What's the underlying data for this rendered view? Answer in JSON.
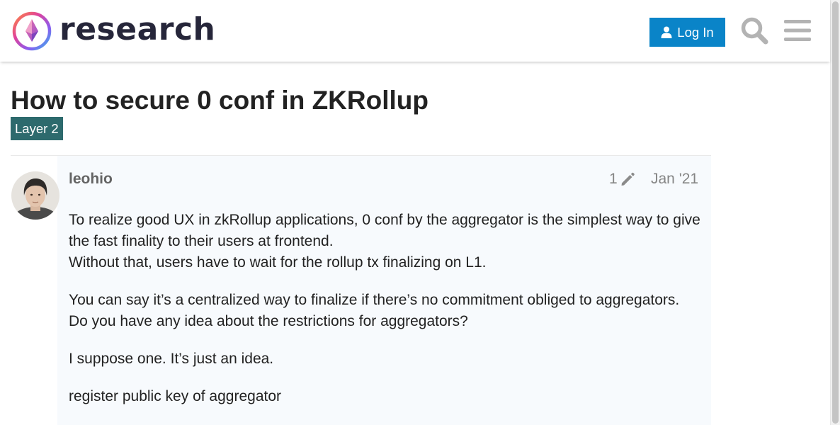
{
  "header": {
    "brand": "research",
    "login_label": "Log In",
    "icons": {
      "logo": "ethereum-research-logo",
      "user": "user-icon",
      "search": "search-icon",
      "menu": "hamburger-menu-icon"
    }
  },
  "topic": {
    "title": "How to secure 0 conf in ZKRollup",
    "category": "Layer 2"
  },
  "post": {
    "username": "leohio",
    "edit_count": "1",
    "date": "Jan '21",
    "paragraphs": [
      [
        "To realize good UX in zkRollup applications, 0 conf by the aggregator is the simplest way to give the fast finality to their users at frontend.",
        "Without that, users have to wait for the rollup tx finalizing on L1."
      ],
      [
        "You can say it’s a centralized way to finalize if there’s no commitment obliged to aggregators.",
        "Do you have any idea about the restrictions for aggregators?"
      ],
      [
        "I suppose one. It’s just an idea."
      ],
      [
        "register public key of aggregator"
      ]
    ]
  },
  "colors": {
    "accent": "#0a84c8",
    "category": "#2d6a6d",
    "post_background": "#f7fafd",
    "muted_text": "#858585"
  }
}
